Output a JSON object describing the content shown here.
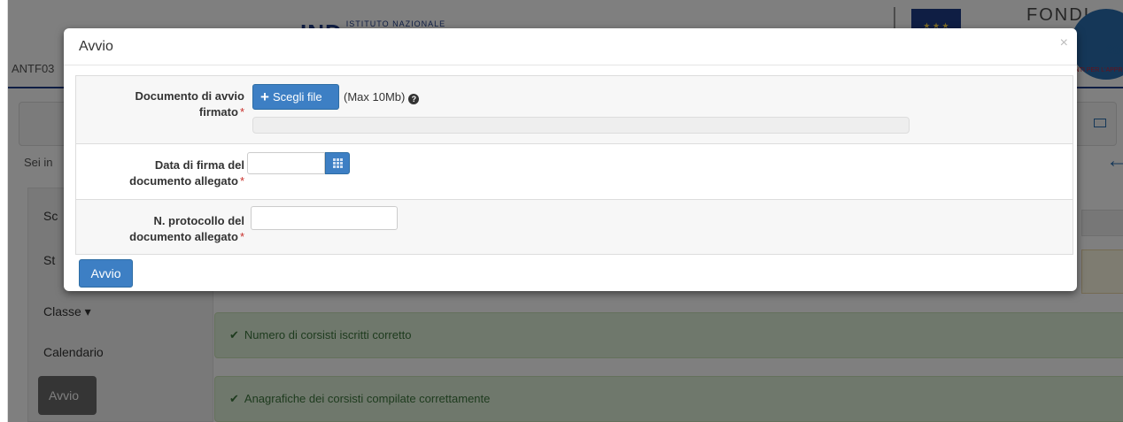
{
  "background": {
    "banner_logo": "IND",
    "banner_logo_sub": "ISTITUTO NAZIONALE",
    "fondi": "FONDI",
    "pon_year": "20",
    "pon_strip": "ENTI PER L'APPR",
    "user_code": "ANTF03",
    "breadcrumb_prefix": "Sei in",
    "sidebar": {
      "items": [
        {
          "label": "Sc"
        },
        {
          "label": "St"
        },
        {
          "label": "Classe ▾"
        },
        {
          "label": "Calendario"
        },
        {
          "label": "Avvio"
        }
      ]
    },
    "alerts": [
      {
        "text": "Numero di corsisti iscritti corretto"
      },
      {
        "text": "Anagrafiche dei corsisti compilate correttamente"
      }
    ]
  },
  "modal": {
    "title": "Avvio",
    "close_label": "×",
    "rows": {
      "document": {
        "label_line1": "Documento di avvio",
        "label_line2": "firmato",
        "required_mark": "*",
        "file_button_icon": "+",
        "file_button_label": "Scegli file",
        "max_note": "(Max 10Mb)",
        "help_icon": "?",
        "file_name_value": ""
      },
      "date": {
        "label_line1": "Data di firma del",
        "label_line2": "documento allegato",
        "required_mark": "*",
        "value": ""
      },
      "protocol": {
        "label_line1": "N. protocollo del",
        "label_line2": "documento allegato",
        "required_mark": "*",
        "value": ""
      }
    },
    "submit_label": "Avvio"
  },
  "colors": {
    "primary_button": "#3d7fc4",
    "success_bg": "#dff0d8",
    "success_text": "#3c763d",
    "required": "#c9302c"
  }
}
